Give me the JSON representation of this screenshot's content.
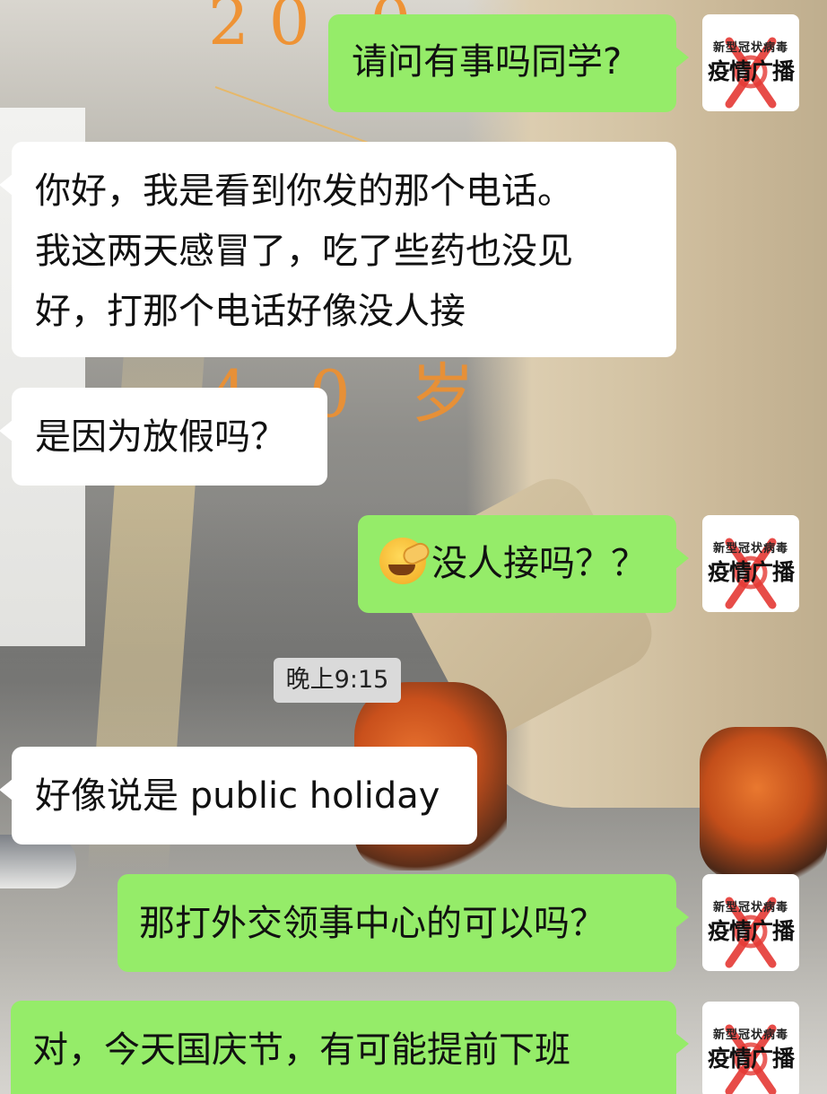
{
  "messages": [
    {
      "id": "m1",
      "side": "right",
      "color": "green",
      "lines": [
        "请问有事吗同学?"
      ]
    },
    {
      "id": "m2",
      "side": "left",
      "color": "white",
      "lines": [
        "你好，我是看到你发的那个电话。",
        "我这两天感冒了，吃了些药也没见",
        "好，打那个电话好像没人接"
      ]
    },
    {
      "id": "m3",
      "side": "left",
      "color": "white",
      "lines": [
        "是因为放假吗？"
      ]
    },
    {
      "id": "m4",
      "side": "right",
      "color": "green",
      "emoji": "face-with-hand-over-eyes-emoji",
      "lines": [
        "没人接吗？？"
      ]
    },
    {
      "id": "m5",
      "side": "left",
      "color": "white",
      "lines": [
        "好像说是 public holiday"
      ]
    },
    {
      "id": "m6",
      "side": "right",
      "color": "green",
      "lines": [
        "那打外交领事中心的可以吗？"
      ]
    },
    {
      "id": "m7",
      "side": "right",
      "color": "green",
      "lines": [
        "对，今天国庆节，有可能提前下班"
      ]
    }
  ],
  "timestamp": "晚上9:15",
  "avatar": {
    "top_text": "新型冠状病毒",
    "big_text": "疫情广播"
  },
  "background_text": {
    "top_number": "20 0",
    "mid_number": "4 0 岁"
  },
  "colors": {
    "green_bubble": "#95ec69",
    "white_bubble": "#ffffff",
    "timestamp_bg": "#dadada",
    "avatar_accent": "#e53935"
  }
}
